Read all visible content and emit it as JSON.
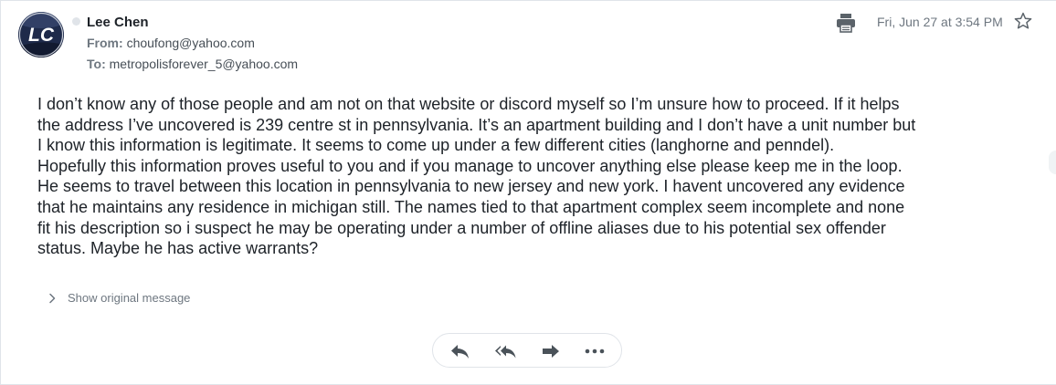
{
  "message": {
    "sender_name": "Lee Chen",
    "avatar_initials": "LC",
    "from_label": "From:",
    "from_email": "choufong@yahoo.com",
    "to_label": "To:",
    "to_email": "metropolisforever_5@yahoo.com",
    "timestamp": "Fri, Jun 27 at 3:54 PM",
    "body_lines": [
      "I don’t know any of those people and am not on that website or discord myself so I’m unsure how to proceed. If it helps",
      "the address I’ve uncovered is 239 centre st in pennsylvania. It’s an apartment building and I don’t have a unit number but",
      "I know this information is legitimate. It seems to come up under a few different cities (langhorne and penndel).",
      "Hopefully this information proves useful to you and if you manage to uncover anything else please keep me in the loop.",
      "He seems to travel between this location in pennsylvania to new jersey and new york. I havent uncovered any evidence",
      "that he maintains any residence in michigan still. The names tied to that apartment complex seem incomplete and none",
      "fit his description so i suspect he may be operating under a number of offline aliases due to his potential sex offender",
      "status. Maybe he has active warrants?"
    ],
    "show_original_label": "Show original message"
  },
  "icons": {
    "print": "printer-icon",
    "star": "star-outline-icon",
    "reply": "reply-icon",
    "reply_all": "reply-all-icon",
    "forward": "forward-icon",
    "more": "more-horizontal-icon",
    "chevron": "chevron-right-icon"
  },
  "colors": {
    "text_primary": "#1d2228",
    "text_secondary": "#6e7780",
    "icon_gray": "#5b636a",
    "avatar_navy": "#1e2a4a",
    "border": "#e0e4e9"
  }
}
